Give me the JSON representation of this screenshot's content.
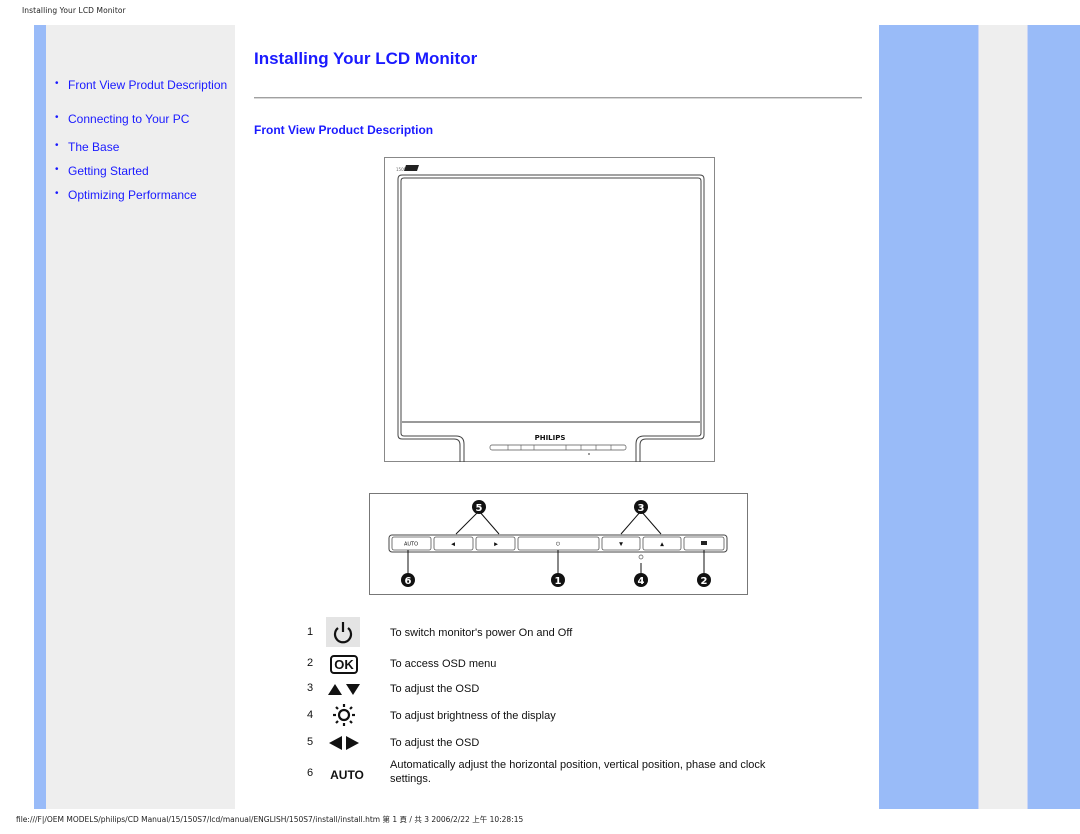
{
  "page_header": "Installing Your LCD Monitor",
  "page_footer": "file:///F|/OEM MODELS/philips/CD Manual/15/150S7/lcd/manual/ENGLISH/150S7/install/install.htm 第 1 頁 / 共 3 2006/2/22 上午 10:28:15",
  "colors": {
    "link": "#1a1aff",
    "accent_stripe": "#99bbf8",
    "panel_bg": "#eeeeee"
  },
  "sidebar": {
    "items": [
      {
        "label": "Front View Produt Description"
      },
      {
        "label": "Connecting to Your PC"
      },
      {
        "label": "The Base"
      },
      {
        "label": "Getting Started"
      },
      {
        "label": "Optimizing Performance"
      }
    ]
  },
  "main": {
    "title": "Installing Your LCD Monitor",
    "section_title": "Front View Product Description",
    "monitor_image": {
      "brand": "PHILIPS",
      "model_badge": "150S"
    },
    "control_panel_image": {
      "buttons": [
        "AUTO",
        "◀",
        "▶",
        "⏻",
        "▼",
        "▲",
        "OK"
      ],
      "callouts": [
        "5",
        "3",
        "6",
        "1",
        "4",
        "2"
      ]
    },
    "legend": [
      {
        "num": "1",
        "icon": "power-icon",
        "desc": "To switch monitor's power On and Off"
      },
      {
        "num": "2",
        "icon": "ok-icon",
        "icon_text": "OK",
        "desc": "To access OSD menu"
      },
      {
        "num": "3",
        "icon": "up-down-arrows-icon",
        "desc": "To adjust the OSD"
      },
      {
        "num": "4",
        "icon": "brightness-icon",
        "desc": "To adjust brightness of the display"
      },
      {
        "num": "5",
        "icon": "left-right-arrows-icon",
        "desc": "To adjust the OSD"
      },
      {
        "num": "6",
        "icon": "auto-label",
        "icon_text": "AUTO",
        "desc": "Automatically adjust the horizontal position, vertical position, phase and clock settings."
      }
    ]
  }
}
